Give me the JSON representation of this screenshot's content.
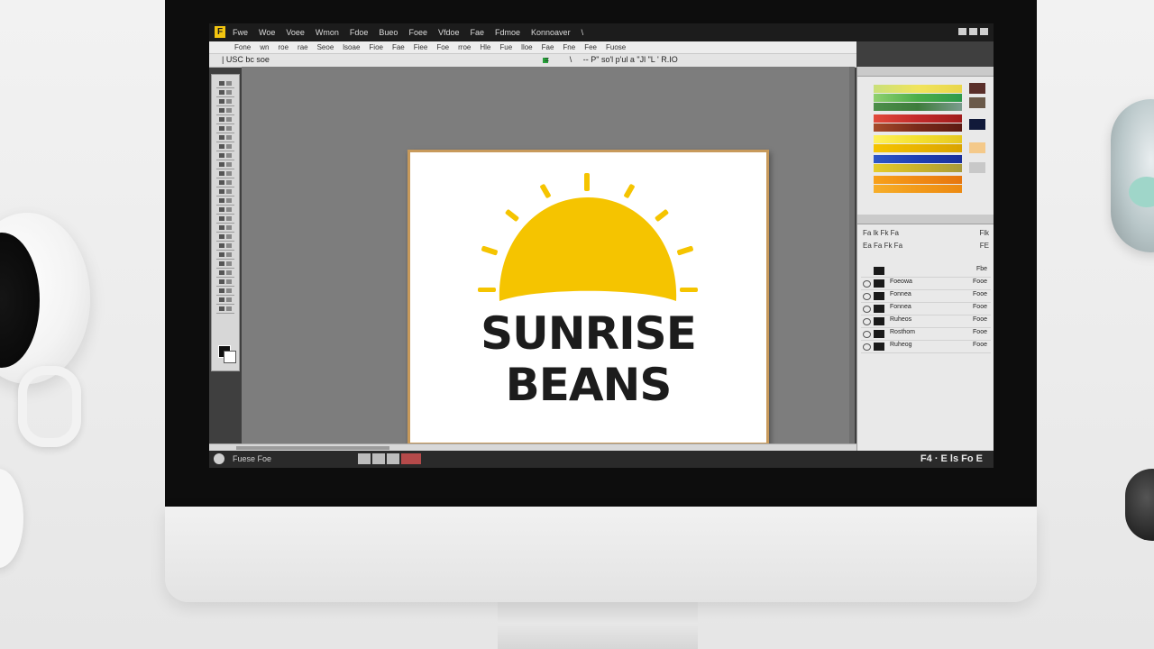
{
  "app": {
    "logo_letter": "F",
    "menus": [
      "Fwe",
      "Woe",
      "Voee",
      "Wmon",
      "Fdoe",
      "Bueo",
      "Foee",
      "Vfdoe",
      "Fae",
      "Fdmoe",
      "Konnoaver",
      "\\"
    ]
  },
  "options_bar": {
    "items": [
      "Fone",
      "wn",
      "roe",
      "rae",
      "Seoe",
      "lsoae",
      "Fioe",
      "Fae",
      "Fiee",
      "Foe",
      "rroe",
      "Hle",
      "Fue",
      "lloe",
      "Fae",
      "Fne",
      "Fee",
      "Fuose"
    ]
  },
  "tab": {
    "label": "| USC bc soe",
    "info": "=         \\     -- P\" so'l p'ul a \"Jl \"L ' R.IO"
  },
  "document": {
    "line1": "SUNRISE",
    "line2": "BEANS",
    "colors": {
      "sun": "#f5c400",
      "text": "#1c1c1c",
      "frame": "#c89a5b"
    }
  },
  "properties": {
    "rows": [
      {
        "label": "Fa  lk  Fk  Fa",
        "value": "Flk"
      },
      {
        "label": "Ea  Fa  Fk  Fa",
        "value": "FE"
      },
      {
        "label": "",
        "value": ""
      }
    ]
  },
  "layers": {
    "rows": [
      {
        "name": "",
        "value": "Fbe"
      },
      {
        "name": "Foeowa",
        "value": "Fooe"
      },
      {
        "name": "Fonnea",
        "value": "Fooe"
      },
      {
        "name": "Fonnea",
        "value": "Fooe"
      },
      {
        "name": "Ruheos",
        "value": "Fooe"
      },
      {
        "name": "Rosthom",
        "value": "Fooe"
      },
      {
        "name": "Ruheog",
        "value": "Fooe"
      }
    ]
  },
  "status": {
    "left": "Fuese  Foe",
    "right": "F4 ·  E  ls  Fo  E"
  }
}
